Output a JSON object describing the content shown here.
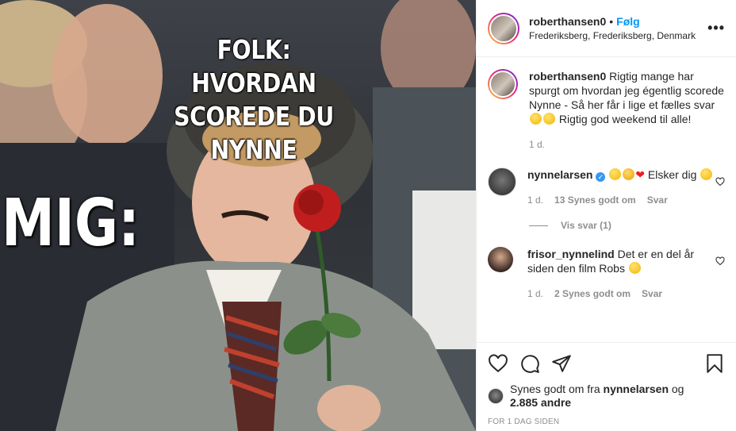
{
  "post": {
    "image": {
      "top_text": "FOLK: HVORDAN SCOREDE DU NYNNE",
      "left_text": "MIG:"
    }
  },
  "header": {
    "username": "roberthansen0",
    "separator": "•",
    "follow_label": "Følg",
    "location": "Frederiksberg, Frederiksberg, Denmark",
    "more_icon": "more-icon"
  },
  "caption": {
    "username": "roberthansen0",
    "text": "Rigtig mange har spurgt om hvordan jeg égentlig scorede Nynne - Så her får i lige et fælles svar",
    "text_after": "Rigtig god weekend til alle!",
    "time": "1 d."
  },
  "comments": [
    {
      "username": "nynnelarsen",
      "verified": true,
      "text": "Elsker dig",
      "time": "1 d.",
      "likes": "13 Synes godt om",
      "reply": "Svar",
      "view_replies": "Vis svar (1)"
    },
    {
      "username": "frisor_nynnelind",
      "text": "Det er en del år siden den film Robs",
      "time": "1 d.",
      "likes": "2 Synes godt om",
      "reply": "Svar"
    }
  ],
  "actions": {
    "liked_by_prefix": "Synes godt om fra",
    "liked_by_user": "nynnelarsen",
    "liked_by_and": "og",
    "others": "2.885 andre",
    "timestamp": "FOR 1 DAG SIDEN"
  },
  "colors": {
    "accent": "#0095f6",
    "muted": "#8e8e8e",
    "text": "#262626",
    "heart": "#ed4956"
  }
}
